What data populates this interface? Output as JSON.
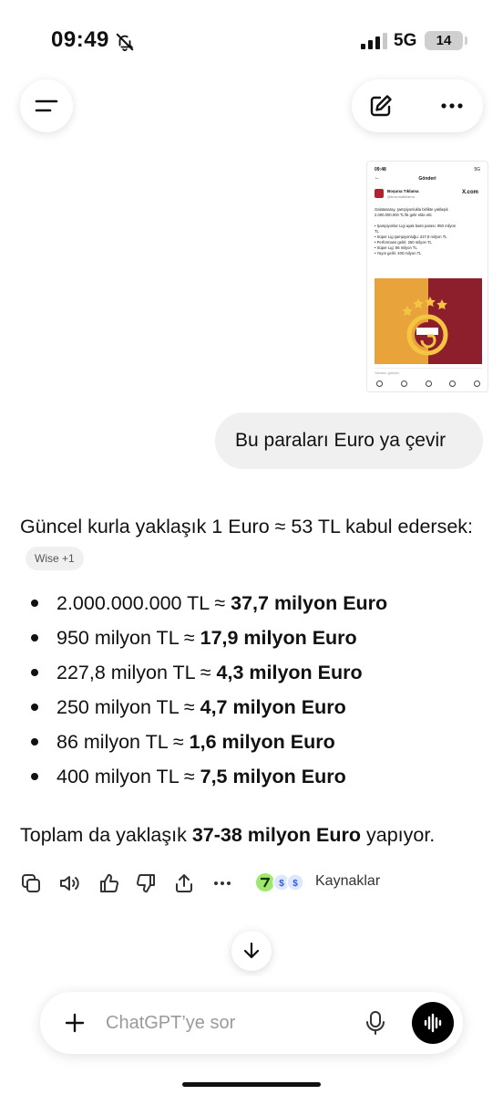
{
  "status_bar": {
    "time": "09:49",
    "network": "5G",
    "battery": "14"
  },
  "header": {
    "menu_icon": "menu-icon",
    "new_chat_icon": "new-chat-icon",
    "more_icon": "more-dots-icon"
  },
  "attachment": {
    "thumb_time": "09:48",
    "thumb_status_right": "5G",
    "thumb_header": "Gönderi",
    "thumb_name": "Boşuna Tıklama",
    "thumb_handle": "@bosunatiklama",
    "thumb_source": "X.com",
    "thumb_lines": [
      "Galatasaray, şampiyonlukla birlikte yaklaşık",
      "2.000.000.000 TL'lik gelir elde etti.",
      "",
      "• Şampiyonlar Ligi ayak bastı parası: 950 milyon",
      "TL",
      "• Süper Lig şampiyonluğu: 227,8 milyon TL",
      "• Performans geliri: 250 milyon TL",
      "• Süper Lig: 86 milyon TL",
      "• Yayın geliri: 400 milyon TL"
    ],
    "thumb_reply_placeholder": "Yanıtını gönder"
  },
  "user_message": "Bu paraları Euro ya çevir",
  "assistant": {
    "intro": "Güncel kurla yaklaşık 1 Euro ≈ 53 TL kabul edersek:",
    "source_chip": "Wise +1",
    "items": [
      {
        "tl": "2.000.000.000 TL ≈ ",
        "eur": "37,7 milyon Euro"
      },
      {
        "tl": "950 milyon TL ≈ ",
        "eur": "17,9 milyon Euro"
      },
      {
        "tl": "227,8 milyon TL ≈ ",
        "eur": "4,3 milyon Euro"
      },
      {
        "tl": "250 milyon TL ≈ ",
        "eur": "4,7 milyon Euro"
      },
      {
        "tl": "86 milyon TL ≈ ",
        "eur": "1,6 milyon Euro"
      },
      {
        "tl": "400 milyon TL ≈ ",
        "eur": "7,5 milyon Euro"
      }
    ],
    "total_prefix": "Toplam da yaklaşık ",
    "total_value": "37-38 milyon Euro",
    "total_suffix": " yapıyor."
  },
  "actions": {
    "sources_label": "Kaynaklar",
    "icons": [
      "copy-icon",
      "read-aloud-icon",
      "thumbs-up-icon",
      "thumbs-down-icon",
      "share-icon",
      "more-icon"
    ]
  },
  "composer": {
    "placeholder": "ChatGPT’ye sor"
  },
  "colors": {
    "bubble": "#f0f0f0",
    "galatasaray_yellow": "#e8a33b",
    "galatasaray_red": "#8d1f2d",
    "wise_green": "#9fe870"
  }
}
